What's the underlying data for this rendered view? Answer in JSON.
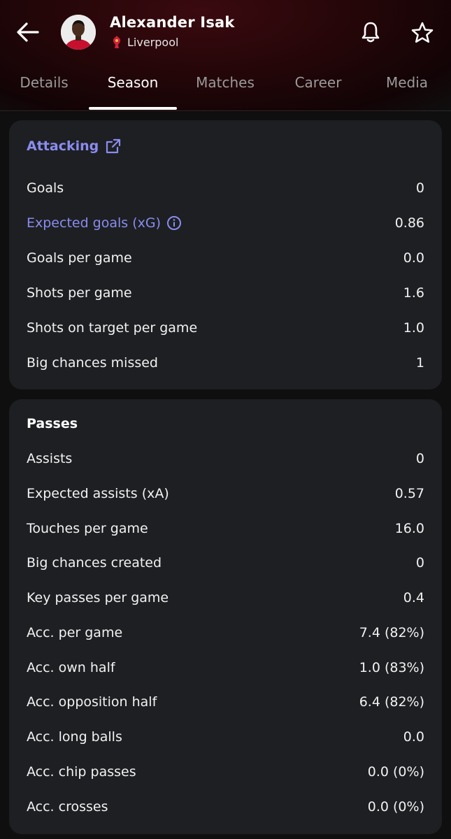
{
  "header": {
    "player_name": "Alexander Isak",
    "team_name": "Liverpool",
    "back_icon": "arrow-left-icon",
    "notify_icon": "bell-icon",
    "favorite_icon": "star-icon"
  },
  "tabs": [
    {
      "label": "Details",
      "active": false
    },
    {
      "label": "Season",
      "active": true
    },
    {
      "label": "Matches",
      "active": false
    },
    {
      "label": "Career",
      "active": false
    },
    {
      "label": "Media",
      "active": false
    }
  ],
  "attacking": {
    "title": "Attacking",
    "rows": [
      {
        "label": "Goals",
        "value": "0"
      },
      {
        "label": "Expected goals (xG)",
        "value": "0.86"
      },
      {
        "label": "Goals per game",
        "value": "0.0"
      },
      {
        "label": "Shots per game",
        "value": "1.6"
      },
      {
        "label": "Shots on target per game",
        "value": "1.0"
      },
      {
        "label": "Big chances missed",
        "value": "1"
      }
    ]
  },
  "passes": {
    "title": "Passes",
    "rows": [
      {
        "label": "Assists",
        "value": "0"
      },
      {
        "label": "Expected assists (xA)",
        "value": "0.57"
      },
      {
        "label": "Touches per game",
        "value": "16.0"
      },
      {
        "label": "Big chances created",
        "value": "0"
      },
      {
        "label": "Key passes per game",
        "value": "0.4"
      },
      {
        "label": "Acc. per game",
        "value": "7.4 (82%)"
      },
      {
        "label": "Acc. own half",
        "value": "1.0 (83%)"
      },
      {
        "label": "Acc. opposition half",
        "value": "6.4 (82%)"
      },
      {
        "label": "Acc. long balls",
        "value": "0.0"
      },
      {
        "label": "Acc. chip passes",
        "value": "0.0 (0%)"
      },
      {
        "label": "Acc. crosses",
        "value": "0.0 (0%)"
      }
    ]
  },
  "colors": {
    "accent_link": "#8a8cf0",
    "card_bg": "#1d1f22",
    "page_bg": "#0f0f0f",
    "header_tint": "#3a0a10"
  }
}
